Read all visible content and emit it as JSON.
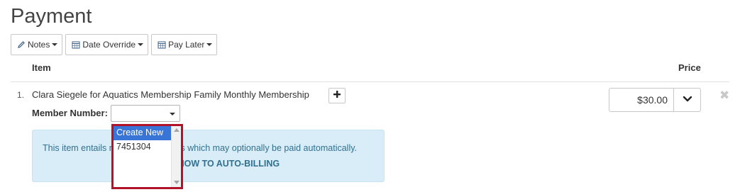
{
  "page": {
    "title": "Payment"
  },
  "toolbar": {
    "notes_label": "Notes",
    "date_override_label": "Date Override",
    "pay_later_label": "Pay Later"
  },
  "table": {
    "headers": {
      "item": "Item",
      "price": "Price"
    },
    "rows": [
      {
        "number": "1.",
        "item_name": "Clara Siegele for Aquatics Membership Family Monthly Membership",
        "member_number_label": "Member Number:",
        "member_number_value": "",
        "price": "$30.00",
        "info_text": "This item entails recurring payments which may optionally be paid automatically.",
        "info_link": "SIGN UP NOW TO AUTO-BILLING"
      }
    ]
  },
  "member_dropdown": {
    "options": [
      "Create New",
      "7451304"
    ],
    "selected": "Create New"
  },
  "icons": {
    "notes": "pencil-icon",
    "date_override": "calendar-icon",
    "pay_later": "calendar-icon",
    "add": "plus-icon",
    "price_menu": "chevron-down-icon",
    "remove": "close-icon"
  },
  "colors": {
    "info_bg": "#d8edf7",
    "info_text": "#31708f",
    "dropdown_highlight": "#b0132a",
    "option_selected": "#3875d7"
  }
}
